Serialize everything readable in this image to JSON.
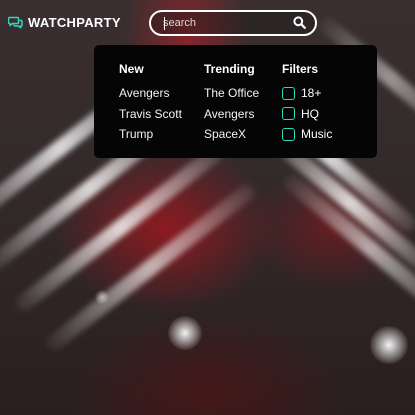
{
  "app": {
    "name": "WATCHPARTY",
    "accent_color": "#2fd9c0",
    "logo_icon": "chat-bubbles-icon"
  },
  "search": {
    "placeholder": "search",
    "value": "",
    "icon": "search-icon"
  },
  "dropdown": {
    "new": {
      "heading": "New",
      "items": [
        "Avengers",
        "Travis Scott",
        "Trump"
      ]
    },
    "trending": {
      "heading": "Trending",
      "items": [
        "The Office",
        "Avengers",
        "SpaceX"
      ]
    },
    "filters": {
      "heading": "Filters",
      "items": [
        {
          "label": "18+",
          "checked": false
        },
        {
          "label": "HQ",
          "checked": false
        },
        {
          "label": "Music",
          "checked": false
        }
      ]
    }
  }
}
